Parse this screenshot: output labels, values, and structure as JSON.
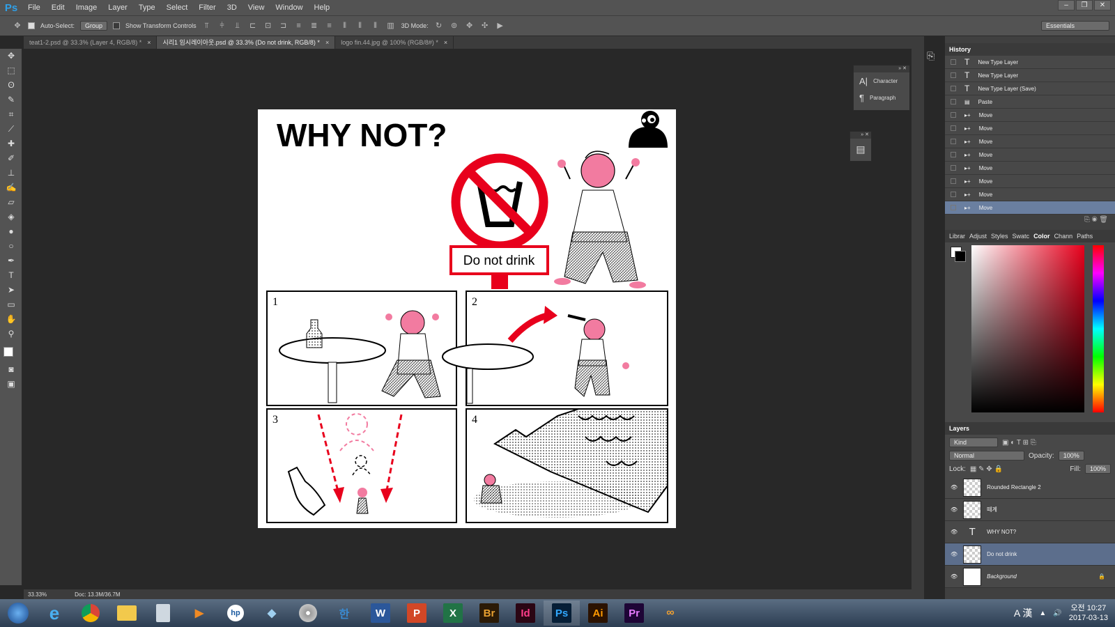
{
  "app": {
    "logo": "Ps"
  },
  "menu": [
    "File",
    "Edit",
    "Image",
    "Layer",
    "Type",
    "Select",
    "Filter",
    "3D",
    "View",
    "Window",
    "Help"
  ],
  "options": {
    "auto_select": "Auto-Select:",
    "auto_select_value": "Group",
    "show_transform": "Show Transform Controls",
    "mode3d": "3D Mode:",
    "workspace": "Essentials"
  },
  "tabs": [
    {
      "label": "teat1-2.psd @ 33.3% (Layer 4, RGB/8) *",
      "close": "×"
    },
    {
      "label": "시리1 임시레이아웃.psd @ 33.3% (Do not drink, RGB/8) *",
      "close": "×"
    },
    {
      "label": "logo fin.44.jpg @ 100% (RGB/8#) *",
      "close": "×"
    }
  ],
  "artwork": {
    "title": "WHY NOT?",
    "sign_text": "Do not drink",
    "panel_numbers": [
      "1",
      "2",
      "3",
      "4"
    ]
  },
  "status": {
    "zoom": "33.33%",
    "doc": "Doc: 13.3M/36.7M"
  },
  "char_panel": {
    "items": [
      "Character",
      "Paragraph"
    ]
  },
  "history": {
    "title": "History",
    "items": [
      "New Type Layer",
      "New Type Layer",
      "New Type Layer (Save)",
      "Paste",
      "Move",
      "Move",
      "Move",
      "Move",
      "Move",
      "Move",
      "Move",
      "Move"
    ]
  },
  "color_tabs": [
    "Librar",
    "Adjust",
    "Styles",
    "Swatc",
    "Color",
    "Chann",
    "Paths"
  ],
  "layers_panel": {
    "title": "Layers",
    "kind": "Kind",
    "blend": "Normal",
    "opacity_label": "Opacity:",
    "opacity": "100%",
    "lock_label": "Lock:",
    "fill_label": "Fill:",
    "fill": "100%",
    "items": [
      "Rounded Rectangle 2",
      "떼계",
      "WHY NOT?",
      "Do not drink",
      "Background"
    ]
  },
  "tray": {
    "lang": "A 漢",
    "ampm": "오전 10:27",
    "date": "2017-03-13"
  },
  "taskbar_apps": [
    "Br",
    "Id",
    "Ps",
    "Ai",
    "Pr"
  ],
  "colors": {
    "accent_red": "#e8001c",
    "pink": "#f27ba0",
    "selection": "#6a7fa0"
  }
}
